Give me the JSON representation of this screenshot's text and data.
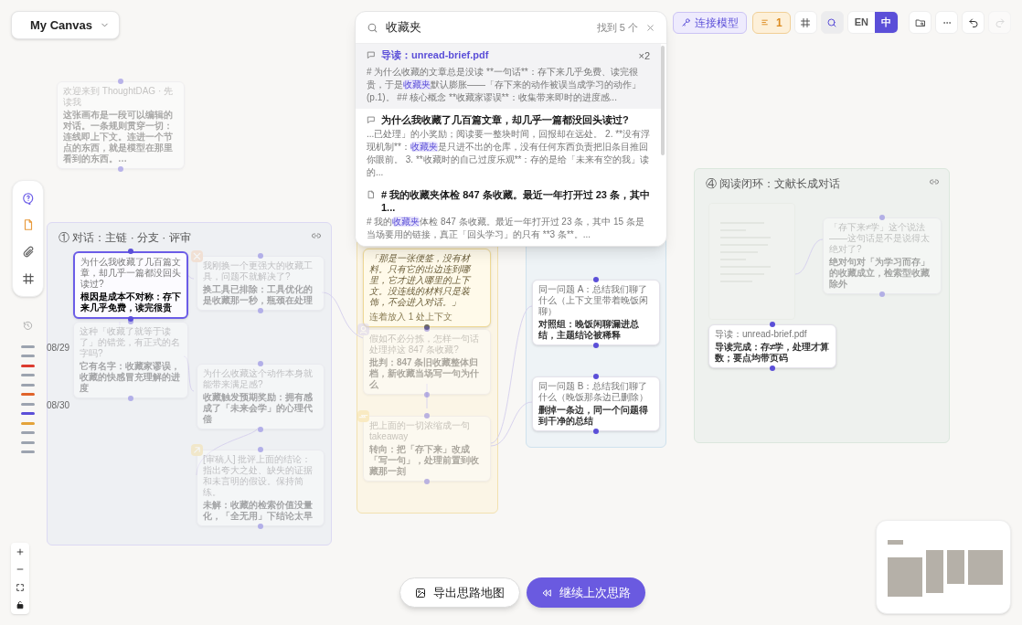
{
  "canvas_menu": {
    "label": "My Canvas"
  },
  "toolbar": {
    "connect_model": "连接模型",
    "queue_count": "1",
    "search_active": true,
    "redo_disabled": true,
    "languages": [
      {
        "label": "EN",
        "selected": false
      },
      {
        "label": "中",
        "selected": true
      }
    ]
  },
  "search": {
    "query": "收藏夹",
    "count": "找到 5 个",
    "results": [
      {
        "kind": "reading",
        "title": "导读：unread-brief.pdf",
        "count": "×2",
        "selected": true,
        "segments": [
          "# 为什么收藏的文章总是没读 **一句话**：存下来几乎免费、读完很贵，于是",
          "收藏夹",
          "默认膨胀——「存下来的动作被误当成学习的动作」(p.1)。 ## 核心概念 **收藏家谬误**：收集带来即时的进度感..."
        ]
      },
      {
        "kind": "question",
        "title": "为什么我收藏了几百篇文章，却几乎一篇都没回头读过?",
        "selected": false,
        "segments": [
          "...已处理」的小奖励；阅读要一整块时间，回报却在远处。 2. **没有浮现机制**：",
          "收藏夹",
          "是只进不出的仓库，没有任何东西负责把旧条目推回你眼前。 3. **收藏时的自己过度乐观**：存的是给「未来有空的我」读的..."
        ]
      },
      {
        "kind": "note",
        "title": "# 我的收藏夹体检 847 条收藏。最近一年打开过 23 条，其中 1...",
        "selected": false,
        "segments": [
          "# 我的",
          "收藏夹",
          "体检 847 条收藏。最近一年打开过 23 条，其中 15 条是当场要用的链接，真正「回头学习」的只有 **3 条**。..."
        ]
      }
    ]
  },
  "timeline": {
    "ticks": [
      {
        "color": "#9ca3af",
        "date": "08/29"
      },
      {
        "color": "#9ca3af"
      },
      {
        "color": "#dc3b2f"
      },
      {
        "color": "#9ca3af"
      },
      {
        "color": "#9ca3af"
      },
      {
        "color": "#e0632a"
      },
      {
        "color": "#9ca3af",
        "date": "08/30"
      },
      {
        "color": "#5b4fd8"
      },
      {
        "color": "#e3a33a"
      },
      {
        "color": "#9ca3af"
      },
      {
        "color": "#9ca3af"
      },
      {
        "color": "#9ca3af"
      }
    ]
  },
  "welcome_node": {
    "caption": "欢迎来到 ThoughtDAG · 先读我",
    "text": "这张画布是一段可以编辑的对话。一条规则贯穿一切：连线即上下文。连进一个节点的东西，就是模型在那里看到的东西。…",
    "dimmed": true
  },
  "groups": [
    {
      "title": "① 对话：主链 · 分支 · 评审",
      "color": "#eef0f3",
      "nodes": [
        {
          "kind": "message",
          "caption": "为什么我收藏了几百篇文章，却几乎一篇都没回头读过?",
          "text": "根因是成本不对称：存下来几乎免费，读完很贵",
          "selected": true,
          "dimmed": false
        },
        {
          "kind": "message",
          "caption": "我刚换一个更强大的收藏工具，问题不就解决了?",
          "text": "换工具已排除：工具优化的是收藏那一秒，瓶颈在处理",
          "selected": false,
          "dimmed": true,
          "badge": {
            "kind": "reject"
          }
        },
        {
          "kind": "message",
          "caption": "这种「收藏了就等于读了」的错觉，有正式的名字吗?",
          "text": "它有名字：收藏家谬误，收藏的快感冒充理解的进度",
          "selected": false,
          "dimmed": true
        },
        {
          "kind": "message",
          "caption": "为什么收藏这个动作本身就能带来满足感?",
          "text": "收藏触发预期奖励：拥有感成了「未来会学」的心理代偿",
          "selected": false,
          "dimmed": true
        },
        {
          "kind": "message",
          "caption": "[审稿人] 批评上面的结论：指出夸大之处、缺失的证据和未言明的假设。保持简练。",
          "text": "未解：收藏的检索价值没量化，「全无用」下结论太早",
          "selected": false,
          "dimmed": true,
          "badge": {
            "kind": "review"
          }
        }
      ]
    },
    {
      "color": "#fbf5e6",
      "nodes": [
        {
          "kind": "note",
          "text": "「那是一张便签，没有材料。只有它的出边连到哪里，它才进入哪里的上下文。没连线的材料只是装饰，不会进入对话。」",
          "footer": "连着放入 1 处上下文",
          "dimmed": false
        },
        {
          "kind": "message",
          "caption": "假如不必分拣，怎样一句话处理掉这 847 条收藏?",
          "text": "批判：847 条旧收藏整体归档，新收藏当场写一句为什么",
          "selected": false,
          "dimmed": true,
          "badge": {
            "kind": "critique"
          }
        },
        {
          "kind": "message",
          "caption": "把上面的一切浓缩成一句 takeaway",
          "text": "转向：把「存下来」改成「写一句」，处理前置到收藏那一刻",
          "selected": false,
          "dimmed": true,
          "badge": {
            "kind": "pivot"
          }
        }
      ]
    },
    {
      "color": "#eef3f6",
      "nodes": [
        {
          "kind": "message",
          "caption": "同一问题 A：总结我们聊了什么（上下文里带着晚饭闲聊）",
          "text": "对照组：晚饭闲聊漏进总结，主题结论被稀释",
          "selected": false,
          "dimmed": false
        },
        {
          "kind": "message",
          "caption": "同一问题 B：总结我们聊了什么（晚饭那条边已删除）",
          "text": "删掉一条边，同一个问题得到干净的总结",
          "selected": false,
          "dimmed": false
        }
      ]
    },
    {
      "title": "④ 阅读闭环：文献长成对话",
      "color": "#eef1ee",
      "nodes": [
        {
          "kind": "document",
          "dimmed": true
        },
        {
          "kind": "message",
          "caption": "导读：unread-brief.pdf",
          "text": "导读完成：存≠学，处理才算数；要点均带页码",
          "selected": false,
          "dimmed": false
        },
        {
          "kind": "message",
          "caption": "「存下来≠学」这个说法——这句话是不是说得太绝对了?",
          "text": "绝对句对「为学习而存」的收藏成立，检索型收藏除外",
          "selected": false,
          "dimmed": true
        }
      ]
    }
  ],
  "bottom_actions": [
    {
      "kind": "secondary",
      "label": "导出思路地图"
    },
    {
      "kind": "primary",
      "label": "继续上次思路"
    }
  ]
}
